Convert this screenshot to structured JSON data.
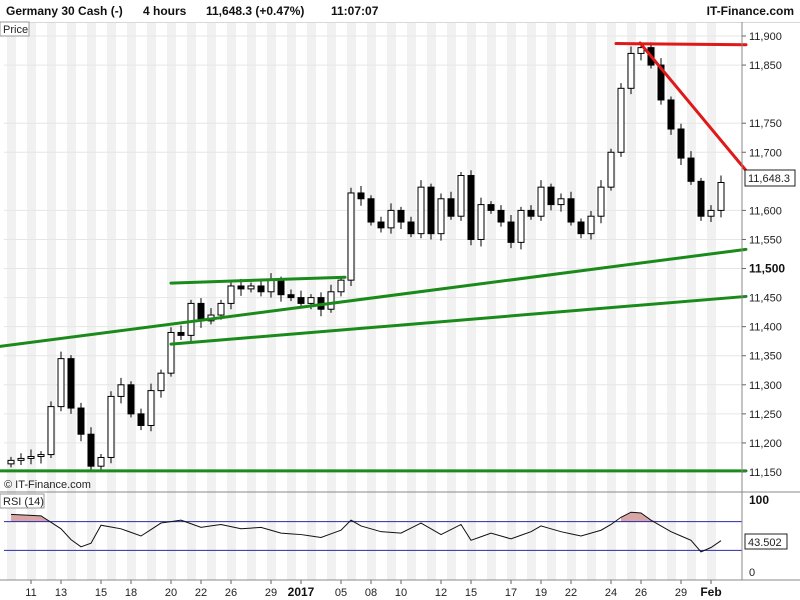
{
  "header": {
    "instrument": "Germany 30 Cash (-)",
    "timeframe": "4 hours",
    "price_change": "11,648.3 (+0.47%)",
    "time": "11:07:07",
    "site": "IT-Finance.com"
  },
  "price_panel": {
    "label": "Price",
    "watermark": "© IT-Finance.com",
    "last_price_label": "11,648.3",
    "ticks": [
      {
        "v": 11900,
        "label": "11,900",
        "bold": false
      },
      {
        "v": 11850,
        "label": "11,850",
        "bold": false
      },
      {
        "v": 11750,
        "label": "11,750",
        "bold": false
      },
      {
        "v": 11700,
        "label": "11,700",
        "bold": false
      },
      {
        "v": 11600,
        "label": "11,600",
        "bold": false
      },
      {
        "v": 11550,
        "label": "11,550",
        "bold": false
      },
      {
        "v": 11500,
        "label": "11,500",
        "bold": true
      },
      {
        "v": 11450,
        "label": "11,450",
        "bold": false
      },
      {
        "v": 11400,
        "label": "11,400",
        "bold": false
      },
      {
        "v": 11350,
        "label": "11,350",
        "bold": false
      },
      {
        "v": 11300,
        "label": "11,300",
        "bold": false
      },
      {
        "v": 11250,
        "label": "11,250",
        "bold": false
      },
      {
        "v": 11200,
        "label": "11,200",
        "bold": false
      },
      {
        "v": 11150,
        "label": "11,150",
        "bold": false
      }
    ]
  },
  "rsi_panel": {
    "label": "RSI (14)",
    "last_value_label": "43.502",
    "ticks": [
      {
        "v": 100,
        "label": "100",
        "bold": true
      },
      {
        "v": 0,
        "label": "0",
        "bold": false
      }
    ]
  },
  "x_axis": {
    "ticks": [
      {
        "label": "11",
        "bold": false
      },
      {
        "label": "13",
        "bold": false
      },
      {
        "label": "15",
        "bold": false
      },
      {
        "label": "18",
        "bold": false
      },
      {
        "label": "20",
        "bold": false
      },
      {
        "label": "22",
        "bold": false
      },
      {
        "label": "26",
        "bold": false
      },
      {
        "label": "29",
        "bold": false
      },
      {
        "label": "2017",
        "bold": true
      },
      {
        "label": "05",
        "bold": false
      },
      {
        "label": "08",
        "bold": false
      },
      {
        "label": "10",
        "bold": false
      },
      {
        "label": "12",
        "bold": false
      },
      {
        "label": "15",
        "bold": false
      },
      {
        "label": "17",
        "bold": false
      },
      {
        "label": "19",
        "bold": false
      },
      {
        "label": "22",
        "bold": false
      },
      {
        "label": "24",
        "bold": false
      },
      {
        "label": "26",
        "bold": false
      },
      {
        "label": "29",
        "bold": false
      },
      {
        "label": "Feb",
        "bold": true
      }
    ]
  },
  "colors": {
    "up": "#ffffff",
    "down": "#000000",
    "support_line": "#1a8a1a",
    "resistance_line": "#e01818",
    "rsi_line": "#111111",
    "rsi_bands": "#2a2aa8",
    "rsi_overbought_fill": "#d9a6a6",
    "stripe": "#f1f1f1"
  },
  "chart_data": {
    "type": "candlestick",
    "title": "Germany 30 Cash (-)",
    "timeframe": "4 hours",
    "last_price": 11648.3,
    "change_pct": 0.47,
    "ylim": [
      11130,
      11910
    ],
    "rsi": {
      "period": 14,
      "last": 43.502,
      "ylim": [
        0,
        100
      ],
      "levels": [
        70,
        30
      ]
    },
    "key_points": [
      [
        0,
        11170
      ],
      [
        3,
        11180
      ],
      [
        5,
        11345
      ],
      [
        6,
        11260
      ],
      [
        7,
        11215
      ],
      [
        8,
        11160
      ],
      [
        9,
        11175
      ],
      [
        10,
        11280
      ],
      [
        11,
        11300
      ],
      [
        12,
        11250
      ],
      [
        13,
        11230
      ],
      [
        14,
        11290
      ],
      [
        15,
        11320
      ],
      [
        16,
        11390
      ],
      [
        17,
        11385
      ],
      [
        18,
        11440
      ],
      [
        19,
        11410
      ],
      [
        20,
        11420
      ],
      [
        21,
        11440
      ],
      [
        22,
        11470
      ],
      [
        23,
        11465
      ],
      [
        24,
        11470
      ],
      [
        25,
        11460
      ],
      [
        26,
        11480
      ],
      [
        27,
        11455
      ],
      [
        28,
        11450
      ],
      [
        29,
        11440
      ],
      [
        30,
        11450
      ],
      [
        31,
        11430
      ],
      [
        32,
        11460
      ],
      [
        33,
        11480
      ],
      [
        34,
        11630
      ],
      [
        35,
        11620
      ],
      [
        36,
        11580
      ],
      [
        37,
        11570
      ],
      [
        38,
        11600
      ],
      [
        39,
        11580
      ],
      [
        40,
        11560
      ],
      [
        41,
        11640
      ],
      [
        42,
        11560
      ],
      [
        43,
        11620
      ],
      [
        44,
        11590
      ],
      [
        45,
        11660
      ],
      [
        46,
        11550
      ],
      [
        47,
        11610
      ],
      [
        48,
        11600
      ],
      [
        49,
        11580
      ],
      [
        50,
        11545
      ],
      [
        51,
        11600
      ],
      [
        52,
        11590
      ],
      [
        53,
        11640
      ],
      [
        54,
        11610
      ],
      [
        55,
        11620
      ],
      [
        56,
        11580
      ],
      [
        57,
        11560
      ],
      [
        58,
        11590
      ],
      [
        59,
        11640
      ],
      [
        60,
        11700
      ],
      [
        61,
        11810
      ],
      [
        62,
        11870
      ],
      [
        63,
        11880
      ],
      [
        64,
        11850
      ],
      [
        65,
        11790
      ],
      [
        66,
        11740
      ],
      [
        67,
        11690
      ],
      [
        68,
        11650
      ],
      [
        69,
        11590
      ],
      [
        70,
        11600
      ],
      [
        71,
        11648
      ]
    ],
    "rsi_key_points": [
      [
        0,
        80
      ],
      [
        3,
        78
      ],
      [
        5,
        60
      ],
      [
        6,
        45
      ],
      [
        7,
        35
      ],
      [
        8,
        40
      ],
      [
        9,
        65
      ],
      [
        11,
        60
      ],
      [
        13,
        50
      ],
      [
        15,
        68
      ],
      [
        17,
        72
      ],
      [
        19,
        62
      ],
      [
        21,
        66
      ],
      [
        23,
        60
      ],
      [
        25,
        62
      ],
      [
        27,
        54
      ],
      [
        29,
        52
      ],
      [
        31,
        48
      ],
      [
        33,
        58
      ],
      [
        34,
        72
      ],
      [
        35,
        64
      ],
      [
        37,
        56
      ],
      [
        39,
        54
      ],
      [
        41,
        68
      ],
      [
        43,
        52
      ],
      [
        45,
        66
      ],
      [
        46,
        44
      ],
      [
        48,
        54
      ],
      [
        50,
        46
      ],
      [
        52,
        56
      ],
      [
        53,
        64
      ],
      [
        55,
        56
      ],
      [
        57,
        50
      ],
      [
        59,
        58
      ],
      [
        60,
        66
      ],
      [
        61,
        76
      ],
      [
        62,
        83
      ],
      [
        63,
        82
      ],
      [
        64,
        72
      ],
      [
        66,
        56
      ],
      [
        68,
        44
      ],
      [
        69,
        28
      ],
      [
        70,
        34
      ],
      [
        71,
        43.5
      ]
    ],
    "trendlines": [
      {
        "color": "support",
        "from": [
          -1.6,
          11365
        ],
        "to": [
          73.5,
          11533
        ]
      },
      {
        "color": "support",
        "from": [
          -1.6,
          11152
        ],
        "to": [
          73.5,
          11152
        ]
      },
      {
        "color": "support",
        "from": [
          16.0,
          11475
        ],
        "to": [
          33.4,
          11485
        ]
      },
      {
        "color": "support",
        "from": [
          16.0,
          11370
        ],
        "to": [
          73.5,
          11452
        ]
      },
      {
        "color": "resistance",
        "from": [
          60.5,
          11887
        ],
        "to": [
          73.5,
          11885
        ]
      },
      {
        "color": "resistance",
        "from": [
          62.9,
          11888
        ],
        "to": [
          74.5,
          11648
        ]
      }
    ]
  }
}
